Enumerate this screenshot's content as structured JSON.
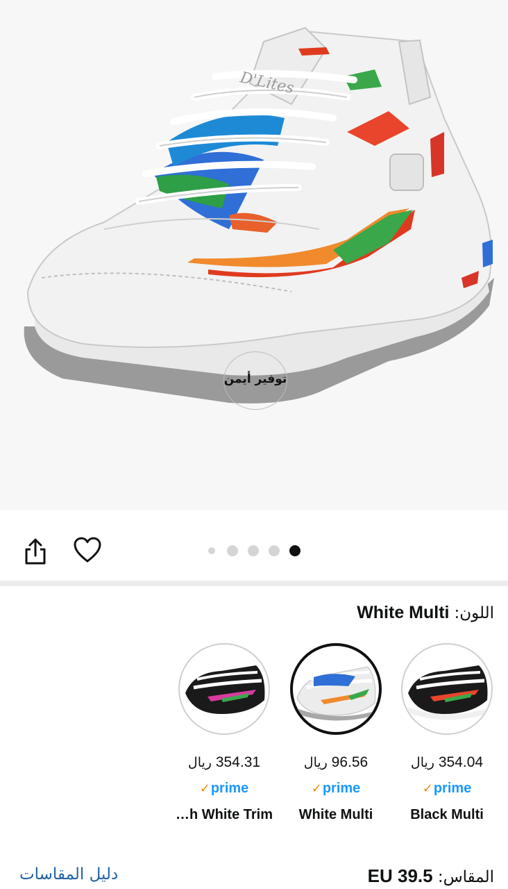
{
  "hero": {
    "watermark_text": "توفير أيمن",
    "shoe_print": "D'Lites"
  },
  "actions": {
    "share_icon": "share-icon",
    "favorite_icon": "heart-icon"
  },
  "carousel": {
    "total": 5,
    "active_index": 4
  },
  "color": {
    "label": "اللون:",
    "selected": "White Multi"
  },
  "swatches": [
    {
      "name": "Black Multi",
      "price": "354.04",
      "currency": "ريال",
      "prime": "prime",
      "selected": false
    },
    {
      "name": "White Multi",
      "price": "96.56",
      "currency": "ريال",
      "prime": "prime",
      "selected": true
    },
    {
      "name": "…h White Trim",
      "price": "354.31",
      "currency": "ريال",
      "prime": "prime",
      "selected": false
    }
  ],
  "size": {
    "label": "المقاس:",
    "selected": "EU 39.5"
  },
  "size_guide": {
    "label": "دليل المقاسات"
  },
  "colors": {
    "prime_blue": "#1a98ff",
    "prime_check": "#f08804",
    "link": "#2162a1",
    "text": "#0f1111"
  }
}
